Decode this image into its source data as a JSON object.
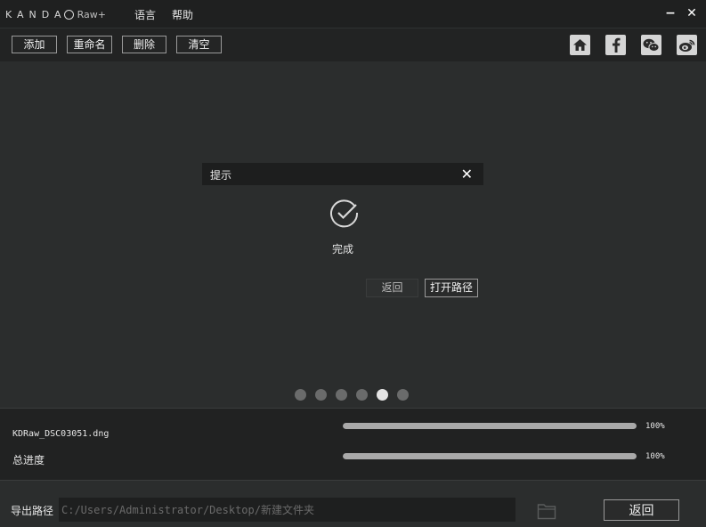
{
  "titlebar": {
    "logo_brand": "KANDA",
    "logo_product": "Raw+",
    "menu": [
      "语言",
      "帮助"
    ],
    "minimize": "−",
    "close": "✕"
  },
  "toolbar": {
    "add_label": "添加",
    "rename_label": "重命名",
    "delete_label": "删除",
    "clear_label": "清空",
    "social_icons": [
      "home-icon",
      "facebook-icon",
      "wechat-icon",
      "weibo-icon"
    ]
  },
  "dialog": {
    "title": "提示",
    "close": "✕",
    "message": "完成",
    "back_label": "返回",
    "open_path_label": "打开路径"
  },
  "carousel": {
    "count": 6,
    "active_index": 4
  },
  "progress": {
    "file": {
      "name": "KDRaw_DSC03051.dng",
      "percent_text": "100%",
      "value": 100
    },
    "total": {
      "label": "总进度",
      "percent_text": "100%",
      "value": 100
    }
  },
  "footer": {
    "export_label": "导出路径",
    "export_path": "C:/Users/Administrator/Desktop/新建文件夹",
    "back_label": "返回"
  },
  "colors": {
    "background": "#2b2d2d",
    "titlebar": "#1f2020",
    "bar_fill": "#a9a9a9",
    "dot_active": "#e4e4e4"
  }
}
